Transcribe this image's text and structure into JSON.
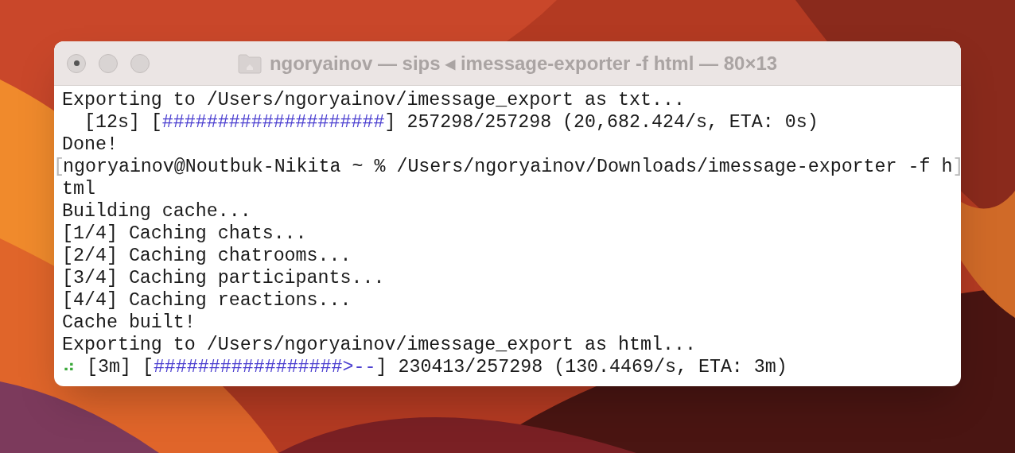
{
  "window": {
    "title": "ngoryainov — sips ◂ imessage-exporter -f html — 80×13"
  },
  "lines": [
    {
      "segments": [
        {
          "kind": "text",
          "text": "Exporting to /Users/ngoryainov/imessage_export as txt..."
        }
      ]
    },
    {
      "segments": [
        {
          "kind": "text",
          "text": "  [12s] ["
        },
        {
          "kind": "bar",
          "text": "####################"
        },
        {
          "kind": "text",
          "text": "] 257298/257298 (20,682.424/s, ETA: 0s)"
        }
      ]
    },
    {
      "segments": [
        {
          "kind": "text",
          "text": "Done!"
        }
      ]
    },
    {
      "segments": [
        {
          "kind": "mark",
          "text": "["
        },
        {
          "kind": "text",
          "text": "ngoryainov@Noutbuk-Nikita ~ % /Users/ngoryainov/Downloads/imessage-exporter -f h"
        },
        {
          "kind": "mark",
          "text": "]"
        }
      ]
    },
    {
      "segments": [
        {
          "kind": "text",
          "text": "tml"
        }
      ]
    },
    {
      "segments": [
        {
          "kind": "text",
          "text": "Building cache..."
        }
      ]
    },
    {
      "segments": [
        {
          "kind": "text",
          "text": "[1/4] Caching chats..."
        }
      ]
    },
    {
      "segments": [
        {
          "kind": "text",
          "text": "[2/4] Caching chatrooms..."
        }
      ]
    },
    {
      "segments": [
        {
          "kind": "text",
          "text": "[3/4] Caching participants..."
        }
      ]
    },
    {
      "segments": [
        {
          "kind": "text",
          "text": "[4/4] Caching reactions..."
        }
      ]
    },
    {
      "segments": [
        {
          "kind": "text",
          "text": "Cache built!"
        }
      ]
    },
    {
      "segments": [
        {
          "kind": "text",
          "text": "Exporting to /Users/ngoryainov/imessage_export as html..."
        }
      ]
    },
    {
      "segments": [
        {
          "kind": "spinner",
          "text": "⠴"
        },
        {
          "kind": "text",
          "text": " [3m] ["
        },
        {
          "kind": "bar",
          "text": "#################>--"
        },
        {
          "kind": "text",
          "text": "] 230413/257298 (130.4469/s, ETA: 3m)"
        }
      ]
    }
  ]
}
